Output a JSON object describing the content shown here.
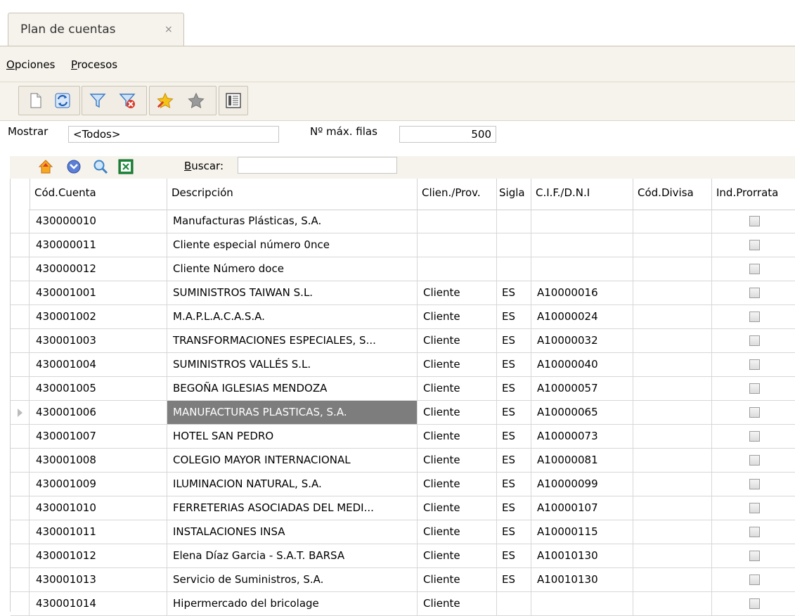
{
  "tab": {
    "title": "Plan de cuentas",
    "close": "×"
  },
  "menu": {
    "opciones": "Opciones",
    "procesos": "Procesos"
  },
  "filter": {
    "mostrar_label": "Mostrar",
    "mostrar_value": "<Todos>",
    "maxfilas_label": "Nº máx. filas",
    "maxfilas_value": "500"
  },
  "search": {
    "label": "Buscar:",
    "value": ""
  },
  "columns": [
    "Cód.Cuenta",
    "Descripción",
    "Clien./Prov.",
    "Sigla",
    "C.I.F./D.N.I",
    "Cód.Divisa",
    "Ind.Prorrata"
  ],
  "rows": [
    {
      "cod": "430000010",
      "desc": "Manufacturas Plásticas, S.A.",
      "tipo": "",
      "sigla": "",
      "cif": "",
      "divisa": ""
    },
    {
      "cod": "430000011",
      "desc": "Cliente especial número 0nce",
      "tipo": "",
      "sigla": "",
      "cif": "",
      "divisa": ""
    },
    {
      "cod": "430000012",
      "desc": "Cliente Número doce",
      "tipo": "",
      "sigla": "",
      "cif": "",
      "divisa": ""
    },
    {
      "cod": "430001001",
      "desc": "SUMINISTROS TAIWAN S.L.",
      "tipo": "Cliente",
      "sigla": "ES",
      "cif": "A10000016",
      "divisa": ""
    },
    {
      "cod": "430001002",
      "desc": "M.A.P.L.A.C.A.S.A.",
      "tipo": "Cliente",
      "sigla": "ES",
      "cif": "A10000024",
      "divisa": ""
    },
    {
      "cod": "430001003",
      "desc": "TRANSFORMACIONES ESPECIALES, S...",
      "tipo": "Cliente",
      "sigla": "ES",
      "cif": "A10000032",
      "divisa": ""
    },
    {
      "cod": "430001004",
      "desc": "SUMINISTROS VALLÉS S.L.",
      "tipo": "Cliente",
      "sigla": "ES",
      "cif": "A10000040",
      "divisa": ""
    },
    {
      "cod": "430001005",
      "desc": "BEGOÑA IGLESIAS MENDOZA",
      "tipo": "Cliente",
      "sigla": "ES",
      "cif": "A10000057",
      "divisa": ""
    },
    {
      "cod": "430001006",
      "desc": "MANUFACTURAS PLASTICAS, S.A.",
      "tipo": "Cliente",
      "sigla": "ES",
      "cif": "A10000065",
      "divisa": ""
    },
    {
      "cod": "430001007",
      "desc": "HOTEL SAN PEDRO",
      "tipo": "Cliente",
      "sigla": "ES",
      "cif": "A10000073",
      "divisa": ""
    },
    {
      "cod": "430001008",
      "desc": "COLEGIO MAYOR INTERNACIONAL",
      "tipo": "Cliente",
      "sigla": "ES",
      "cif": "A10000081",
      "divisa": ""
    },
    {
      "cod": "430001009",
      "desc": "ILUMINACION NATURAL, S.A.",
      "tipo": "Cliente",
      "sigla": "ES",
      "cif": "A10000099",
      "divisa": ""
    },
    {
      "cod": "430001010",
      "desc": "FERRETERIAS ASOCIADAS DEL MEDI...",
      "tipo": "Cliente",
      "sigla": "ES",
      "cif": "A10000107",
      "divisa": ""
    },
    {
      "cod": "430001011",
      "desc": "INSTALACIONES INSA",
      "tipo": "Cliente",
      "sigla": "ES",
      "cif": "A10000115",
      "divisa": ""
    },
    {
      "cod": "430001012",
      "desc": "Elena Díaz Garcia - S.A.T. BARSA",
      "tipo": "Cliente",
      "sigla": "ES",
      "cif": "A10010130",
      "divisa": ""
    },
    {
      "cod": "430001013",
      "desc": "Servicio de Suministros, S.A.",
      "tipo": "Cliente",
      "sigla": "ES",
      "cif": "A10010130",
      "divisa": ""
    },
    {
      "cod": "430001014",
      "desc": "Hipermercado del bricolage",
      "tipo": "Cliente",
      "sigla": "",
      "cif": "",
      "divisa": ""
    }
  ],
  "selected_row": 8,
  "colors": {
    "panel": "#f6f3ec",
    "selected": "#7d7d7d"
  }
}
